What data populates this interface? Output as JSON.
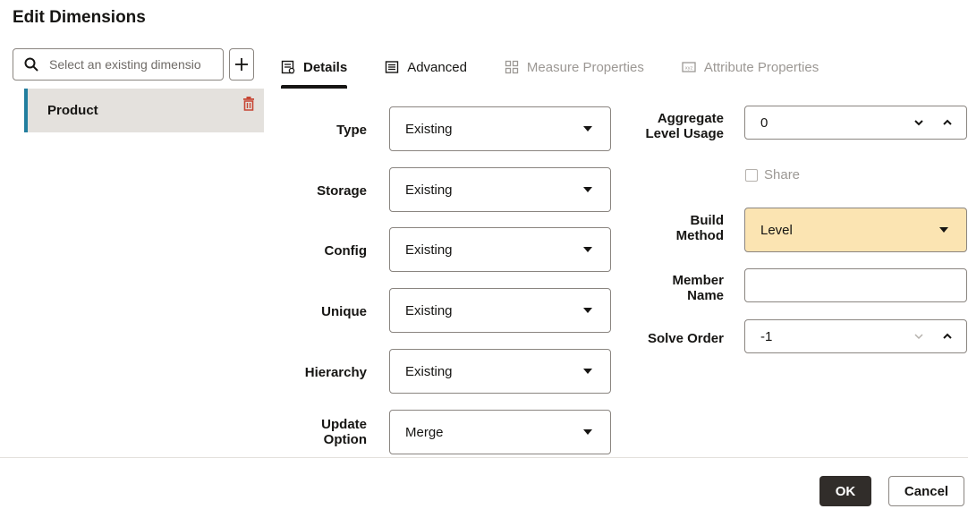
{
  "dialog": {
    "title": "Edit Dimensions"
  },
  "left": {
    "search_placeholder": "Select an existing dimension",
    "dimensions": [
      {
        "label": "Product"
      }
    ]
  },
  "tabs": [
    {
      "label": "Details",
      "state": "active",
      "icon": "details-icon"
    },
    {
      "label": "Advanced",
      "state": "enabled",
      "icon": "advanced-icon"
    },
    {
      "label": "Measure Properties",
      "state": "disabled",
      "icon": "grid-icon"
    },
    {
      "label": "Attribute Properties",
      "state": "disabled",
      "icon": "xyz-icon"
    }
  ],
  "form": {
    "type": {
      "label": "Type",
      "value": "Existing"
    },
    "storage": {
      "label": "Storage",
      "value": "Existing"
    },
    "config": {
      "label": "Config",
      "value": "Existing"
    },
    "unique": {
      "label": "Unique",
      "value": "Existing"
    },
    "hierarchy": {
      "label": "Hierarchy",
      "value": "Existing"
    },
    "update_option": {
      "label_line1": "Update",
      "label_line2": "Option",
      "value": "Merge"
    },
    "aggregate_level_usage": {
      "label_line1": "Aggregate",
      "label_line2": "Level Usage",
      "value": "0"
    },
    "share": {
      "label": "Share",
      "checked": false
    },
    "build_method": {
      "label_line1": "Build",
      "label_line2": "Method",
      "value": "Level"
    },
    "member_name": {
      "label_line1": "Member",
      "label_line2": "Name",
      "value": ""
    },
    "solve_order": {
      "label": "Solve Order",
      "value": "-1"
    }
  },
  "footer": {
    "ok_label": "OK",
    "cancel_label": "Cancel"
  },
  "colors": {
    "accent": "#227e9e",
    "highlight": "#fbe4b2",
    "danger": "#c74634",
    "primary_button": "#312d2a"
  }
}
